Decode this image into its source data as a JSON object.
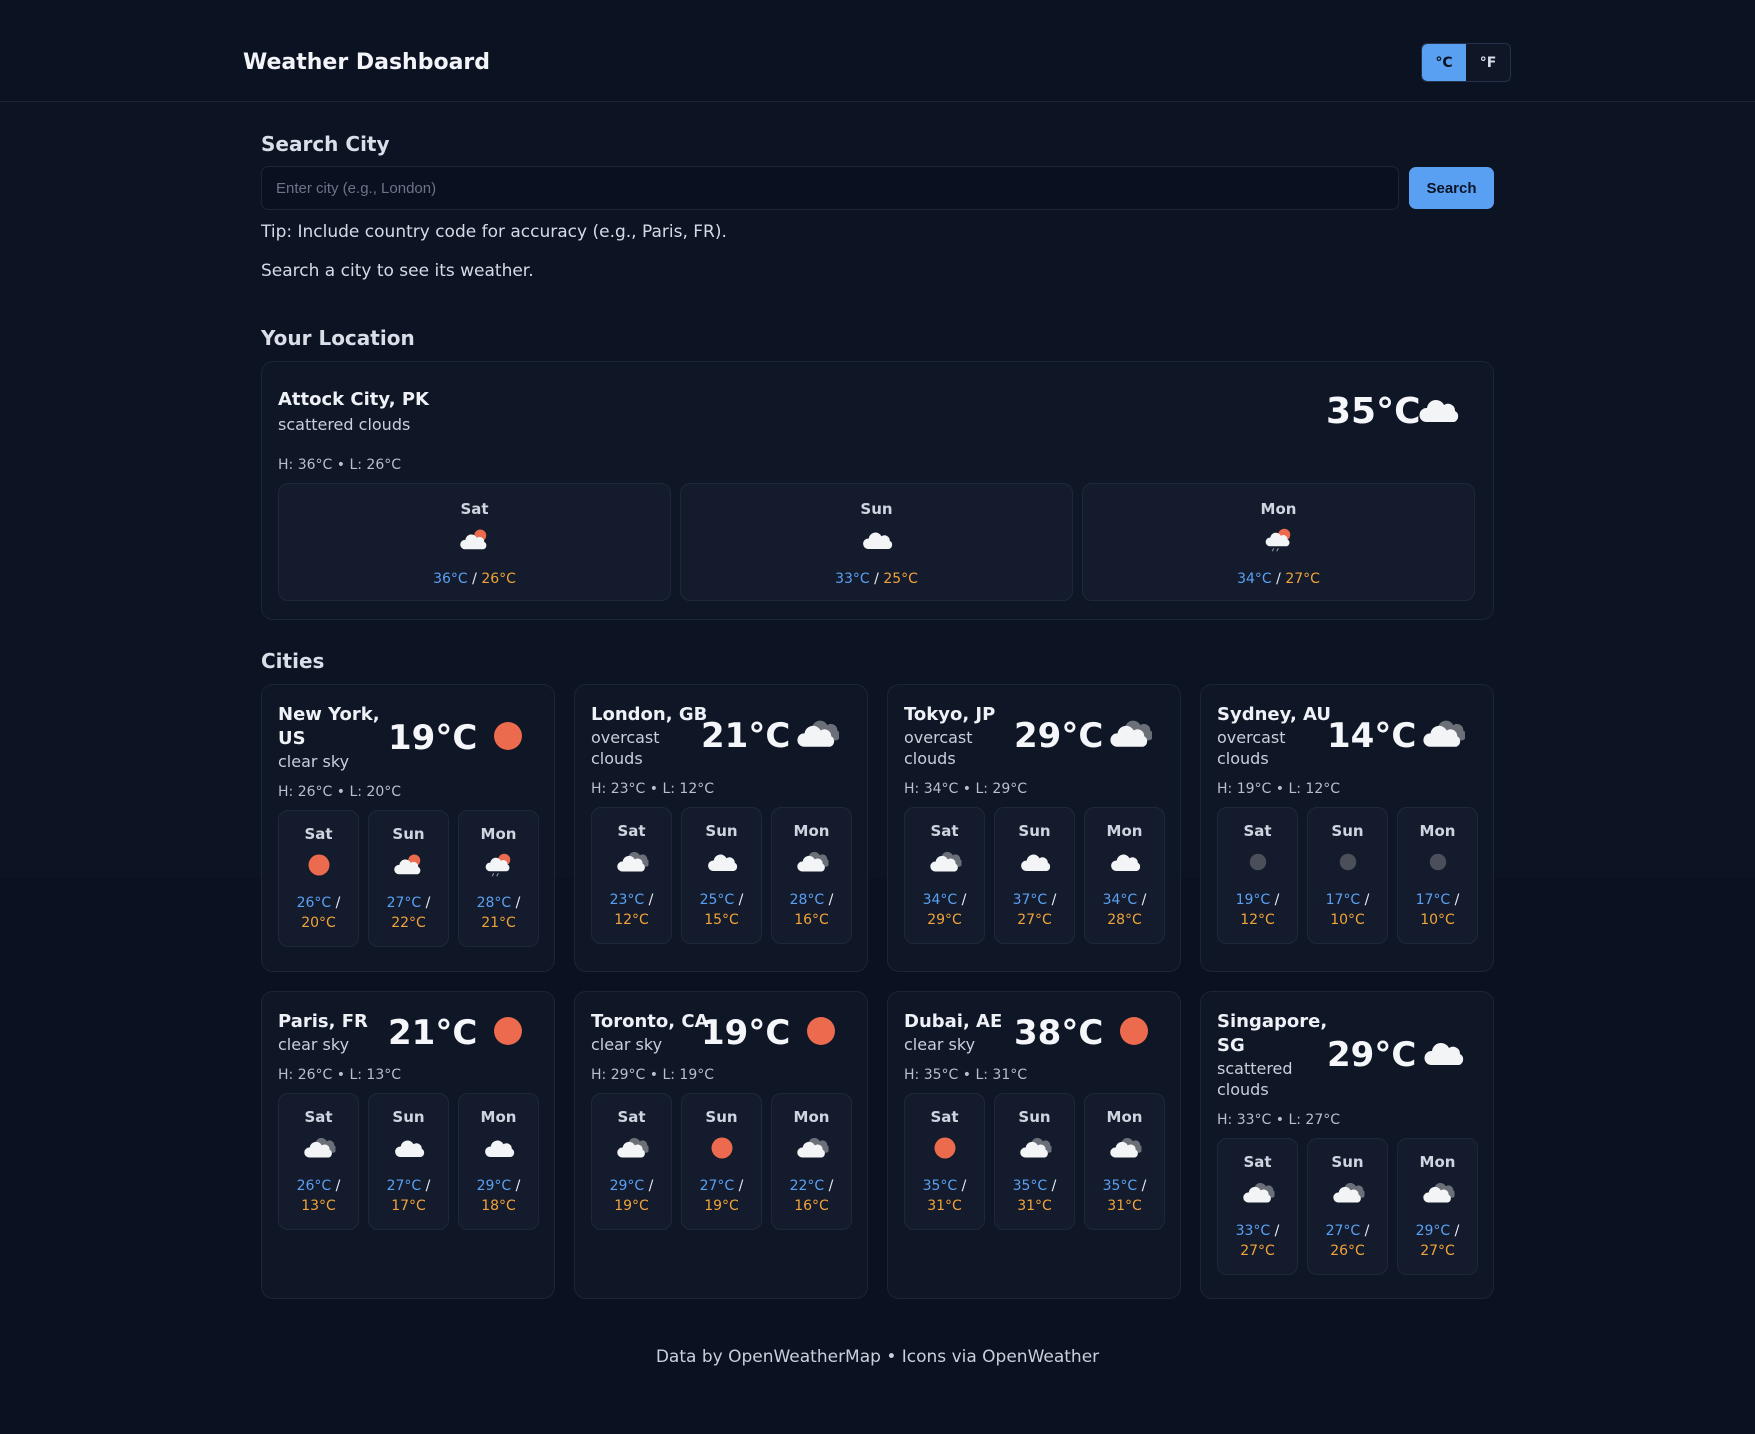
{
  "header": {
    "title": "Weather Dashboard",
    "unit_c": "°C",
    "unit_f": "°F"
  },
  "search": {
    "title": "Search City",
    "placeholder": "Enter city (e.g., London)",
    "button": "Search",
    "tip": "Tip: Include country code for accuracy (e.g., Paris, FR).",
    "status": "Search a city to see its weather."
  },
  "location": {
    "title": "Your Location",
    "city": "Attock City, PK",
    "desc": "scattered clouds",
    "temp": "35°C",
    "icon": "cloud-icon",
    "hl": "H: 36°C • L: 26°C",
    "forecast": [
      {
        "day": "Sat",
        "icon": "cloud-sun-icon",
        "hi": "36°C",
        "lo": "26°C"
      },
      {
        "day": "Sun",
        "icon": "cloud-icon",
        "hi": "33°C",
        "lo": "25°C"
      },
      {
        "day": "Mon",
        "icon": "rain-sun-icon",
        "hi": "34°C",
        "lo": "27°C"
      }
    ]
  },
  "cities_title": "Cities",
  "cities": [
    {
      "name": "New York, US",
      "desc": "clear sky",
      "temp": "19°C",
      "icon": "sun-icon",
      "hl": "H: 26°C • L: 20°C",
      "forecast": [
        {
          "day": "Sat",
          "icon": "sun-icon",
          "hi": "26°C",
          "lo": "20°C"
        },
        {
          "day": "Sun",
          "icon": "cloud-sun-icon",
          "hi": "27°C",
          "lo": "22°C"
        },
        {
          "day": "Mon",
          "icon": "rain-sun-icon",
          "hi": "28°C",
          "lo": "21°C"
        }
      ]
    },
    {
      "name": "London, GB",
      "desc": "overcast clouds",
      "temp": "21°C",
      "icon": "clouds-icon",
      "hl": "H: 23°C • L: 12°C",
      "forecast": [
        {
          "day": "Sat",
          "icon": "clouds-icon",
          "hi": "23°C",
          "lo": "12°C"
        },
        {
          "day": "Sun",
          "icon": "cloud-icon",
          "hi": "25°C",
          "lo": "15°C"
        },
        {
          "day": "Mon",
          "icon": "clouds-icon",
          "hi": "28°C",
          "lo": "16°C"
        }
      ]
    },
    {
      "name": "Tokyo, JP",
      "desc": "overcast clouds",
      "temp": "29°C",
      "icon": "clouds-icon",
      "hl": "H: 34°C • L: 29°C",
      "forecast": [
        {
          "day": "Sat",
          "icon": "clouds-icon",
          "hi": "34°C",
          "lo": "29°C"
        },
        {
          "day": "Sun",
          "icon": "cloud-icon",
          "hi": "37°C",
          "lo": "27°C"
        },
        {
          "day": "Mon",
          "icon": "cloud-icon",
          "hi": "34°C",
          "lo": "28°C"
        }
      ]
    },
    {
      "name": "Sydney, AU",
      "desc": "overcast clouds",
      "temp": "14°C",
      "icon": "clouds-icon",
      "hl": "H: 19°C • L: 12°C",
      "forecast": [
        {
          "day": "Sat",
          "icon": "moon-icon",
          "hi": "19°C",
          "lo": "12°C"
        },
        {
          "day": "Sun",
          "icon": "moon-icon",
          "hi": "17°C",
          "lo": "10°C"
        },
        {
          "day": "Mon",
          "icon": "moon-icon",
          "hi": "17°C",
          "lo": "10°C"
        }
      ]
    },
    {
      "name": "Paris, FR",
      "desc": "clear sky",
      "temp": "21°C",
      "icon": "sun-icon",
      "hl": "H: 26°C • L: 13°C",
      "forecast": [
        {
          "day": "Sat",
          "icon": "clouds-icon",
          "hi": "26°C",
          "lo": "13°C"
        },
        {
          "day": "Sun",
          "icon": "cloud-icon",
          "hi": "27°C",
          "lo": "17°C"
        },
        {
          "day": "Mon",
          "icon": "cloud-icon",
          "hi": "29°C",
          "lo": "18°C"
        }
      ]
    },
    {
      "name": "Toronto, CA",
      "desc": "clear sky",
      "temp": "19°C",
      "icon": "sun-icon",
      "hl": "H: 29°C • L: 19°C",
      "forecast": [
        {
          "day": "Sat",
          "icon": "clouds-icon",
          "hi": "29°C",
          "lo": "19°C"
        },
        {
          "day": "Sun",
          "icon": "sun-icon",
          "hi": "27°C",
          "lo": "19°C"
        },
        {
          "day": "Mon",
          "icon": "clouds-icon",
          "hi": "22°C",
          "lo": "16°C"
        }
      ]
    },
    {
      "name": "Dubai, AE",
      "desc": "clear sky",
      "temp": "38°C",
      "icon": "sun-icon",
      "hl": "H: 35°C • L: 31°C",
      "forecast": [
        {
          "day": "Sat",
          "icon": "sun-icon",
          "hi": "35°C",
          "lo": "31°C"
        },
        {
          "day": "Sun",
          "icon": "clouds-icon",
          "hi": "35°C",
          "lo": "31°C"
        },
        {
          "day": "Mon",
          "icon": "clouds-icon",
          "hi": "35°C",
          "lo": "31°C"
        }
      ]
    },
    {
      "name": "Singapore, SG",
      "desc": "scattered clouds",
      "temp": "29°C",
      "icon": "cloud-icon",
      "hl": "H: 33°C • L: 27°C",
      "forecast": [
        {
          "day": "Sat",
          "icon": "clouds-icon",
          "hi": "33°C",
          "lo": "27°C"
        },
        {
          "day": "Sun",
          "icon": "clouds-icon",
          "hi": "27°C",
          "lo": "26°C"
        },
        {
          "day": "Mon",
          "icon": "clouds-icon",
          "hi": "29°C",
          "lo": "27°C"
        }
      ]
    }
  ],
  "footer": "Data by OpenWeatherMap • Icons via OpenWeather",
  "colors": {
    "accent": "#5aa0f2",
    "high": "#5aa0f2",
    "low": "#f2a33a",
    "sun": "#ec6a4d"
  }
}
